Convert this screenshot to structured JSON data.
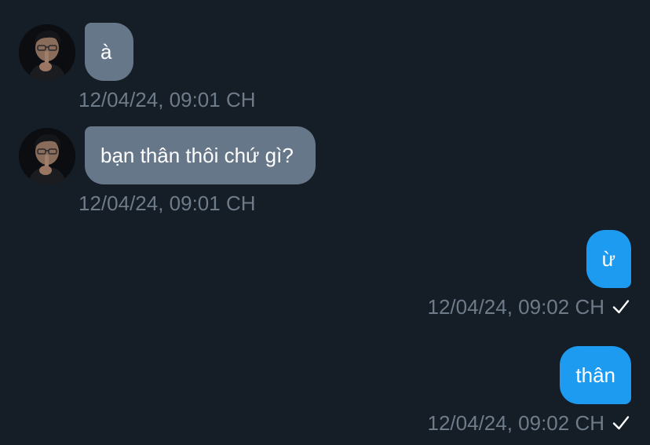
{
  "messages": [
    {
      "direction": "incoming",
      "text": "à",
      "timestamp": "12/04/24, 09:01 CH"
    },
    {
      "direction": "incoming",
      "text": "bạn thân thôi chứ gì?",
      "timestamp": "12/04/24, 09:01 CH"
    },
    {
      "direction": "outgoing",
      "text": "ừ",
      "timestamp": "12/04/24, 09:02 CH",
      "status_icon": "check-icon"
    },
    {
      "direction": "outgoing",
      "text": "thân",
      "timestamp": "12/04/24, 09:02 CH",
      "status_icon": "check-icon"
    }
  ],
  "colors": {
    "background": "#151d27",
    "incoming_bubble": "#66778a",
    "outgoing_bubble": "#1d9bf0",
    "timestamp": "#6e7b89",
    "text": "#ffffff"
  }
}
